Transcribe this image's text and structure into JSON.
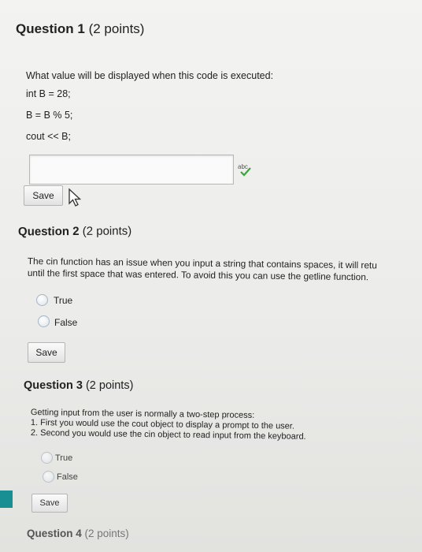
{
  "questions": [
    {
      "number": "Question 1",
      "points": "(2 points)",
      "prompt": "What value will be displayed when this code is executed:",
      "code": [
        "int B = 28;",
        "B = B % 5;",
        "cout << B;"
      ],
      "answer_value": "",
      "save_label": "Save"
    },
    {
      "number": "Question 2",
      "points": "(2 points)",
      "prompt_line1": "The cin function has an issue when you input a string that contains spaces, it will retu",
      "prompt_line2": "until the first space that was entered. To avoid this you can use the getline function.",
      "options": [
        "True",
        "False"
      ],
      "save_label": "Save"
    },
    {
      "number": "Question 3",
      "points": "(2 points)",
      "prompt_line1": "Getting input from the user is normally a two-step process:",
      "prompt_line2": "1. First you would use the cout object to display a prompt to the user.",
      "prompt_line3": "2. Second you would use the cin object to read input from the keyboard.",
      "options": [
        "True",
        "False"
      ],
      "save_label": "Save"
    },
    {
      "number": "Question 4",
      "points": "(2 points)"
    }
  ],
  "spellcheck_icon": "spellcheck-abc-icon",
  "cursor_icon": "mouse-pointer-icon",
  "colors": {
    "accent": "#1a8f93"
  }
}
